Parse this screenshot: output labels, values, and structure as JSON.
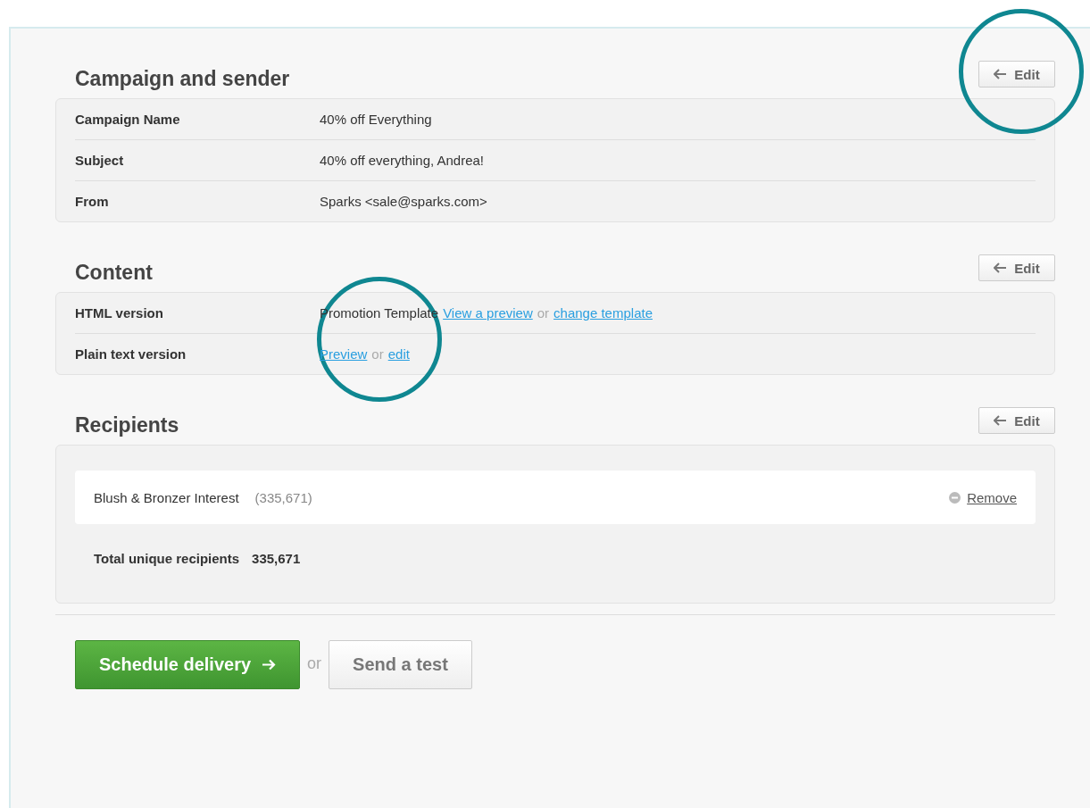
{
  "sections": [
    {
      "title": "Campaign and sender",
      "edit": {
        "label": "Edit",
        "circled": true
      },
      "rows": [
        {
          "label": "Campaign Name",
          "parts": [
            {
              "kind": "text",
              "text": "40% off Everything"
            }
          ]
        },
        {
          "label": "Subject",
          "parts": [
            {
              "kind": "text",
              "text": "40% off everything, Andrea!"
            }
          ]
        },
        {
          "label": "From",
          "parts": [
            {
              "kind": "text",
              "text": "Sparks <sale@sparks.com>"
            }
          ]
        }
      ]
    },
    {
      "title": "Content",
      "edit": {
        "label": "Edit",
        "circled": false
      },
      "rows": [
        {
          "label": "HTML version",
          "parts": [
            {
              "kind": "text",
              "text": "Promotion Template"
            },
            {
              "kind": "link",
              "text": "View a preview"
            },
            {
              "kind": "or",
              "text": "or"
            },
            {
              "kind": "link",
              "text": "change template"
            }
          ]
        },
        {
          "label": "Plain text version",
          "circled": true,
          "parts": [
            {
              "kind": "link",
              "text": "Preview"
            },
            {
              "kind": "or",
              "text": "or"
            },
            {
              "kind": "link",
              "text": "edit"
            }
          ]
        }
      ]
    }
  ],
  "recipients": {
    "title": "Recipients",
    "edit": {
      "label": "Edit",
      "circled": false
    },
    "lists": [
      {
        "name": "Blush & Bronzer Interest",
        "count": "(335,671)",
        "remove": "Remove"
      }
    ],
    "total_label": "Total unique recipients",
    "total": "335,671"
  },
  "actions": {
    "primary": "Schedule delivery",
    "or": "or",
    "secondary": "Send a test"
  }
}
